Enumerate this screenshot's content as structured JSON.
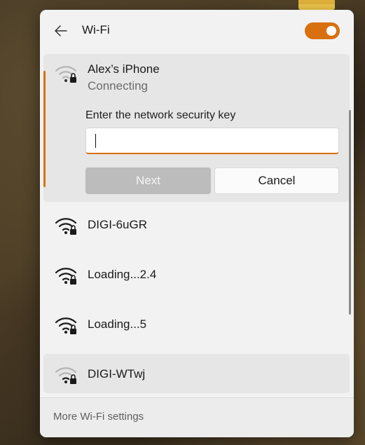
{
  "panel": {
    "title": "Wi-Fi",
    "wifi_enabled": true,
    "accent_color": "#d9700f"
  },
  "connecting_network": {
    "name": "Alex’s iPhone",
    "status": "Connecting",
    "security_key_label": "Enter the network security key",
    "security_key_value": "",
    "next_label": "Next",
    "cancel_label": "Cancel"
  },
  "networks": [
    {
      "name": "DIGI-6uGR",
      "icon": "wifi-secured-full-icon"
    },
    {
      "name": "Loading...2.4",
      "icon": "wifi-secured-full-icon"
    },
    {
      "name": "Loading...5",
      "icon": "wifi-secured-full-icon"
    },
    {
      "name": "DIGI-WTwj",
      "icon": "wifi-secured-weak-icon"
    }
  ],
  "footer": {
    "more_settings_label": "More Wi-Fi settings"
  }
}
